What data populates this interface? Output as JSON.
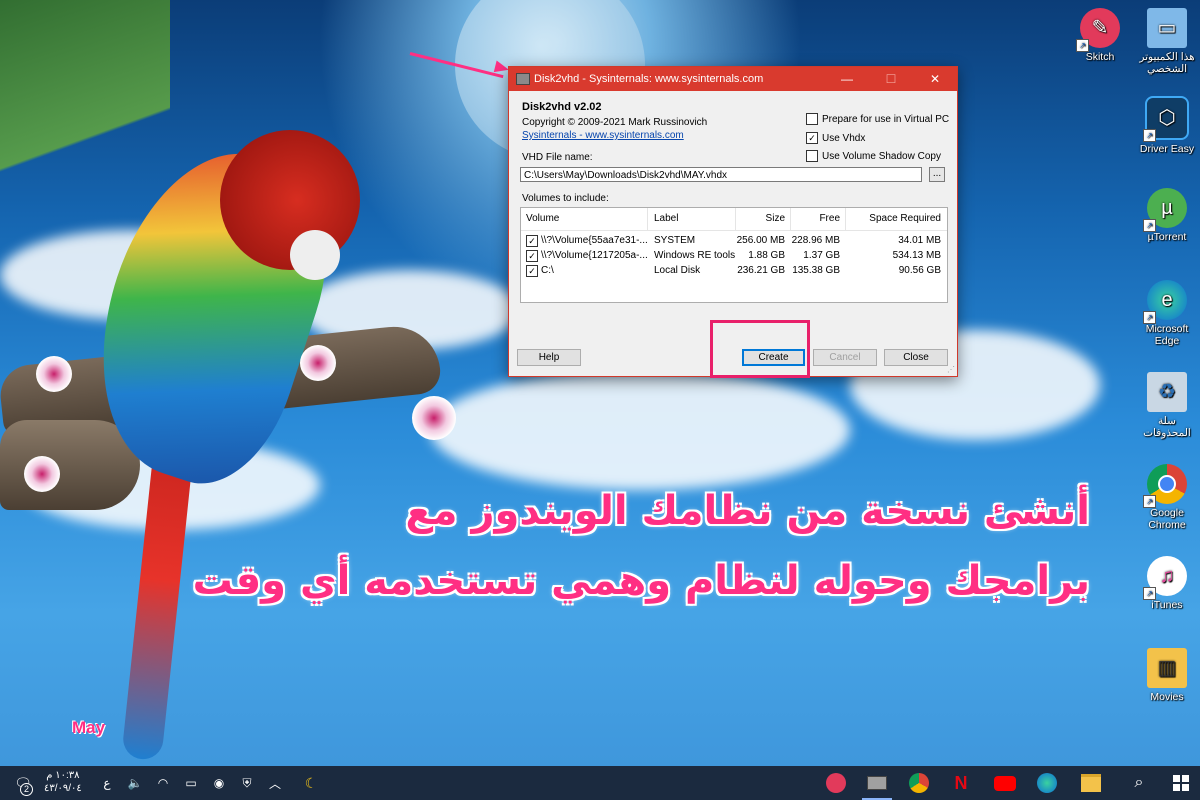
{
  "dialog": {
    "window_title": "Disk2vhd - Sysinternals: www.sysinternals.com",
    "app_title": "Disk2vhd v2.02",
    "copyright": "Copyright  © 2009-2021 Mark Russinovich",
    "link": "Sysinternals - www.sysinternals.com",
    "options": [
      {
        "label": "Prepare for use in Virtual PC",
        "checked": false
      },
      {
        "label": "Use Vhdx",
        "checked": true
      },
      {
        "label": "Use Volume Shadow Copy",
        "checked": false
      }
    ],
    "vhd_label": "VHD File name:",
    "vhd_path": "C:\\Users\\May\\Downloads\\Disk2vhd\\MAY.vhdx",
    "browse_label": "...",
    "volumes_label": "Volumes to include:",
    "columns": [
      "Volume",
      "Label",
      "Size",
      "Free",
      "Space Required"
    ],
    "volumes": [
      {
        "volume": "\\\\?\\Volume{55aa7e31-...",
        "label": "SYSTEM",
        "size": "256.00 MB",
        "free": "228.96 MB",
        "required": "34.01 MB",
        "checked": true
      },
      {
        "volume": "\\\\?\\Volume{1217205a-...",
        "label": "Windows RE tools",
        "size": "1.88 GB",
        "free": "1.37 GB",
        "required": "534.13 MB",
        "checked": true
      },
      {
        "volume": "C:\\",
        "label": "Local Disk",
        "size": "236.21 GB",
        "free": "135.38 GB",
        "required": "90.56 GB",
        "checked": true
      }
    ],
    "buttons": {
      "help": "Help",
      "create": "Create",
      "cancel": "Cancel",
      "close": "Close"
    },
    "window_controls": {
      "minimize": "—",
      "maximize": "☐",
      "close": "✕"
    }
  },
  "overlay": {
    "line1": "أنشئ نسخة من نظامك الويندوز مع",
    "line2": "برامجك وحوله لنظام وهمي تستخدمه أي وقت",
    "signature": "May",
    "accent_color": "#ff2f83"
  },
  "desktop_icons": [
    {
      "name": "Skitch",
      "icon": "skitch-icon"
    },
    {
      "name": "هذا الكمبيوتر الشخصي",
      "icon": "this-pc-icon"
    },
    {
      "name": "Driver Easy",
      "icon": "driver-easy-icon"
    },
    {
      "name": "µTorrent",
      "icon": "utorrent-icon"
    },
    {
      "name": "Microsoft Edge",
      "icon": "edge-icon"
    },
    {
      "name": "سلة المحذوفات",
      "icon": "recycle-bin-icon"
    },
    {
      "name": "Google Chrome",
      "icon": "chrome-icon"
    },
    {
      "name": "iTunes",
      "icon": "itunes-icon"
    },
    {
      "name": "Movies",
      "icon": "folder-icon"
    }
  ],
  "taskbar": {
    "time": "١٠:٣٨ م",
    "date": "٤٣/٠٩/٠٤",
    "lang": "ع",
    "notification_count": "2"
  }
}
